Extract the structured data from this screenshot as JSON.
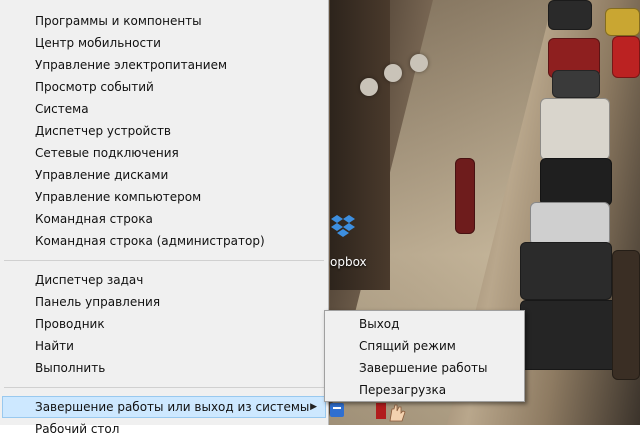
{
  "desktop": {
    "dropbox_label": "opbox"
  },
  "winx_menu": {
    "group1": [
      "Программы и компоненты",
      "Центр мобильности",
      "Управление электропитанием",
      "Просмотр событий",
      "Система",
      "Диспетчер устройств",
      "Сетевые подключения",
      "Управление дисками",
      "Управление компьютером",
      "Командная строка",
      "Командная строка (администратор)"
    ],
    "group2": [
      "Диспетчер задач",
      "Панель управления",
      "Проводник",
      "Найти",
      "Выполнить"
    ],
    "shutdown_label": "Завершение работы или выход из системы",
    "desktop_label": "Рабочий стол"
  },
  "shutdown_submenu": {
    "items": [
      "Выход",
      "Спящий режим",
      "Завершение работы",
      "Перезагрузка"
    ]
  },
  "colors": {
    "menu_bg": "#f0f0f0",
    "highlight_bg": "#cde8ff",
    "highlight_border": "#99c9ef"
  }
}
